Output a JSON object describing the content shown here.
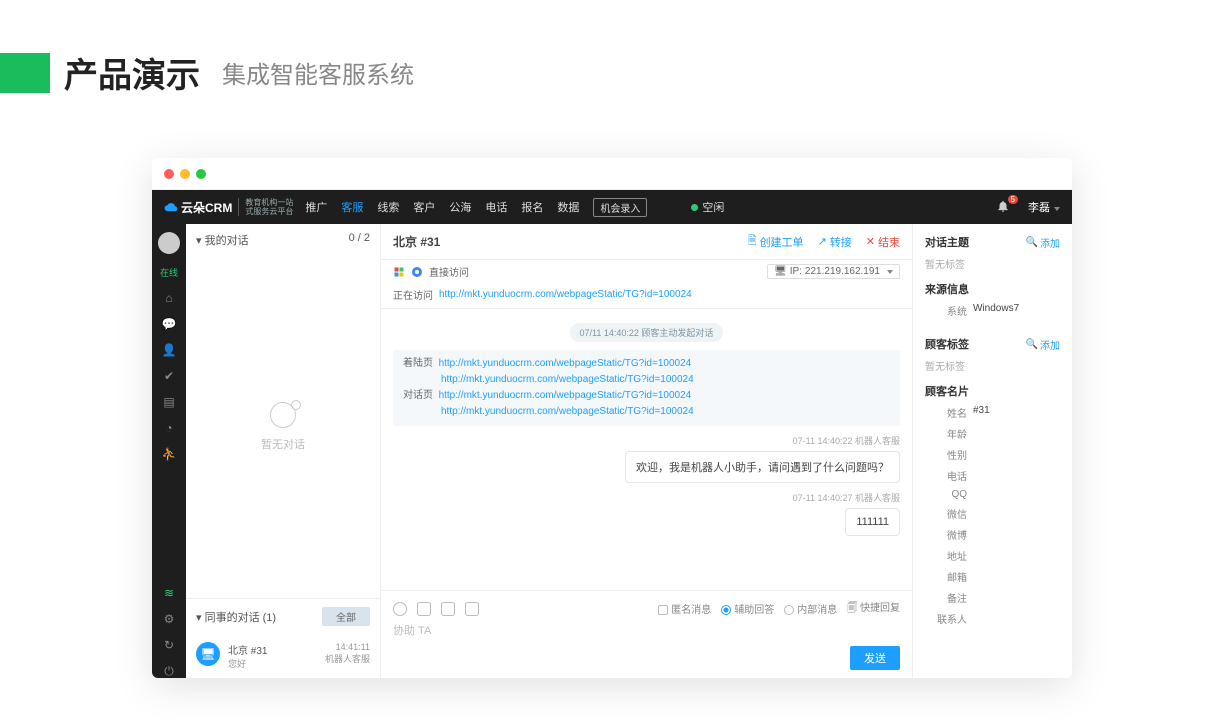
{
  "slide": {
    "title": "产品演示",
    "subtitle": "集成智能客服系统"
  },
  "logo": {
    "name": "云朵CRM",
    "url": "www.yunduocrm.com",
    "tag1": "教育机构一站",
    "tag2": "式服务云平台"
  },
  "nav": {
    "items": [
      "推广",
      "客服",
      "线索",
      "客户",
      "公海",
      "电话",
      "报名",
      "数据"
    ],
    "active": "客服",
    "record": "机会录入",
    "status": "空闲",
    "notif": "5",
    "user": "李磊"
  },
  "rail": {
    "status": "在线"
  },
  "conv": {
    "mine_title": "我的对话",
    "mine_count": "0 / 2",
    "empty": "暂无对话",
    "coll_title": "同事的对话  (1)",
    "all": "全部",
    "item": {
      "name": "北京 #31",
      "msg": "您好",
      "time": "14:41:11",
      "agent": "机器人客服"
    }
  },
  "chat": {
    "title": "北京 #31",
    "act_ticket": "创建工单",
    "act_transfer": "转接",
    "act_end": "结束",
    "direct": "直接访问",
    "ip_label": "IP:",
    "ip": "221.219.162.191",
    "visit_label": "正在访问",
    "visit_url": "http://mkt.yunduocrm.com/webpageStatic/TG?id=100024",
    "time_pill": "07/11 14:40:22  顾客主动发起对话",
    "land_label": "着陆页",
    "dlg_label": "对话页",
    "url1": "http://mkt.yunduocrm.com/webpageStatic/TG?id=100024",
    "url2": "http://mkt.yunduocrm.com/webpageStatic/TG?id=100024",
    "url3": "http://mkt.yunduocrm.com/webpageStatic/TG?id=100024",
    "url4": "http://mkt.yunduocrm.com/webpageStatic/TG?id=100024",
    "meta1": "07-11 14:40:22  机器人客服",
    "bubble1": "欢迎，我是机器人小助手，请问遇到了什么问题吗？",
    "meta2": "07-11 14:40:27  机器人客服",
    "bubble2": "111111",
    "opt_anon": "匿名消息",
    "opt_assist": "辅助回答",
    "opt_internal": "内部消息",
    "opt_quick": "快捷回复",
    "placeholder": "协助 TA",
    "send": "发送"
  },
  "side": {
    "topic_title": "对话主题",
    "add": "添加",
    "no_tag": "暂无标签",
    "source_title": "来源信息",
    "sys_label": "系统",
    "sys_val": "Windows7",
    "cust_tag_title": "顾客标签",
    "card_title": "顾客名片",
    "fields": {
      "name_l": "姓名",
      "name_v": "#31",
      "age": "年龄",
      "sex": "性别",
      "tel": "电话",
      "qq": "QQ",
      "wx": "微信",
      "weibo": "微博",
      "addr": "地址",
      "mail": "邮箱",
      "note": "备注",
      "contact": "联系人"
    }
  }
}
